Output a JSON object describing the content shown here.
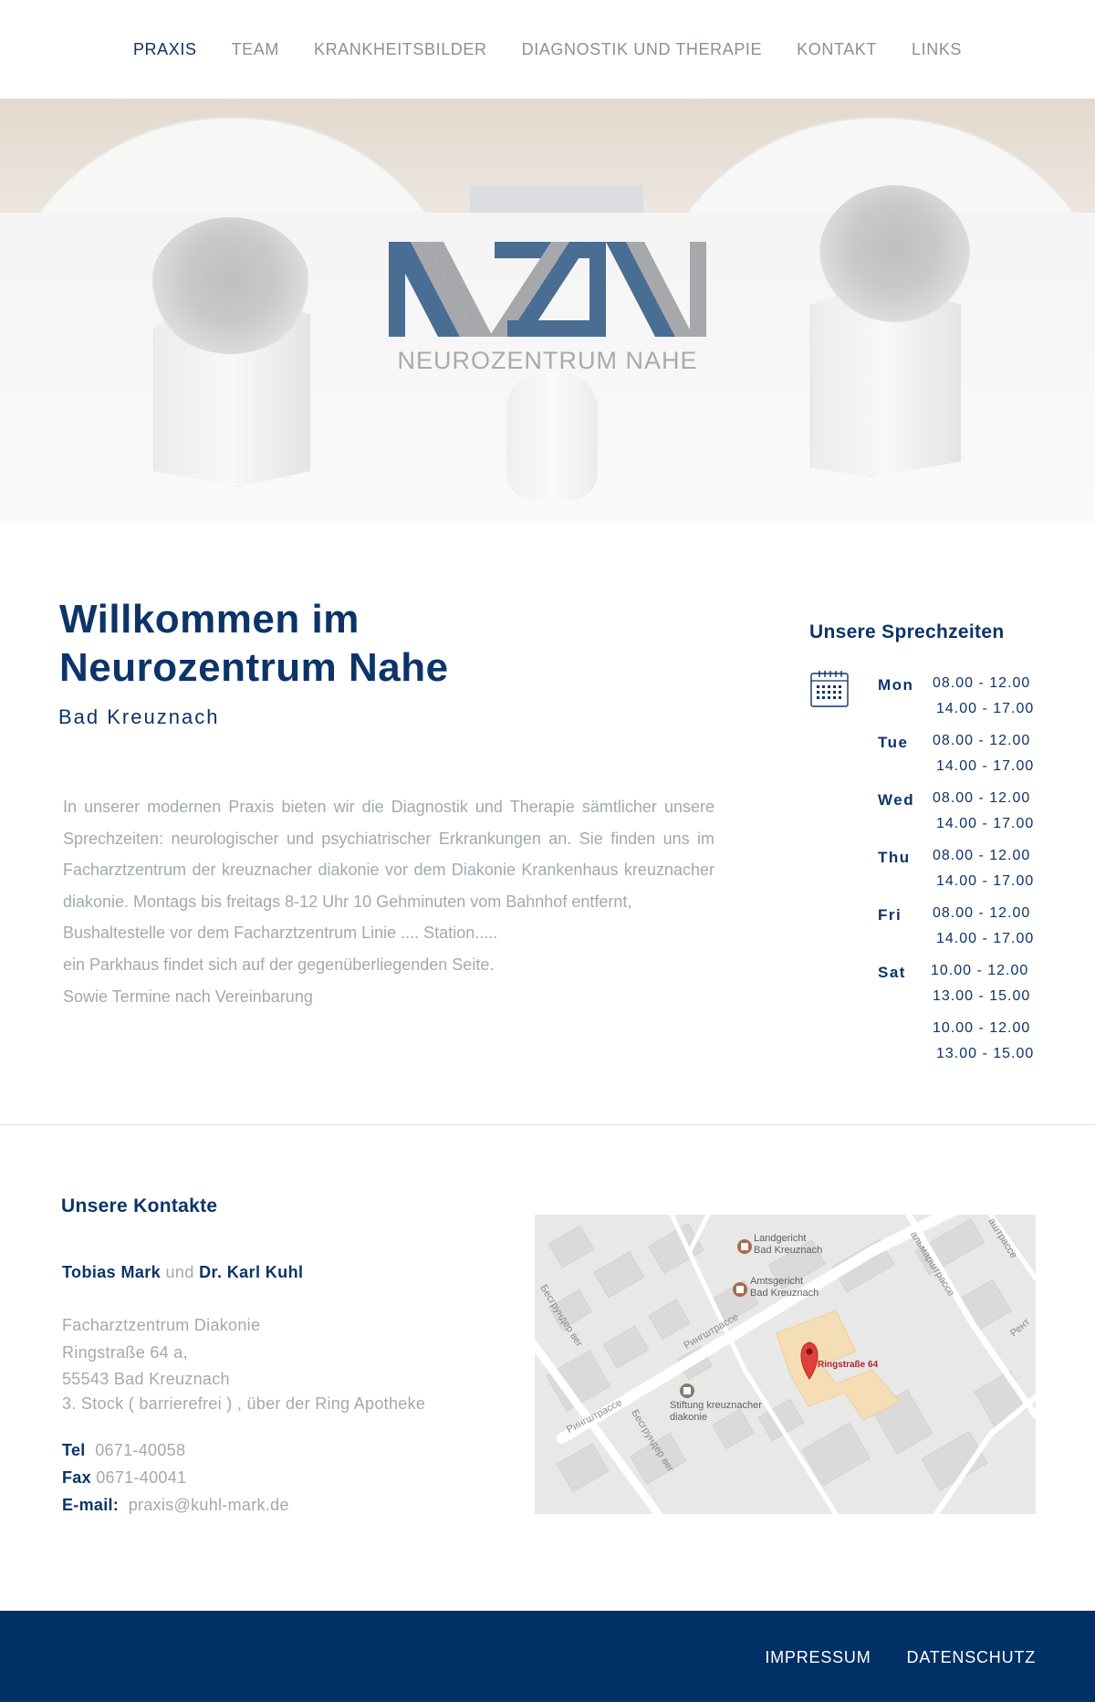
{
  "nav": {
    "items": [
      {
        "label": "PRAXIS"
      },
      {
        "label": "TEAM"
      },
      {
        "label": "KRANKHEITSBILDER"
      },
      {
        "label": "DIAGNOSTIK UND THERAPIE"
      },
      {
        "label": "KONTAKT"
      },
      {
        "label": "LINKS"
      }
    ]
  },
  "hero": {
    "logo_mark": "NZN",
    "logo_text": "NEUROZENTRUM NAHE",
    "logo_colors": {
      "blue": "#4a6d94",
      "gray": "#a7a8ab"
    }
  },
  "welcome": {
    "title_line1": "Willkommen im",
    "title_line2": "Neurozentrum Nahe",
    "subtitle": "Bad Kreuznach",
    "paragraph": [
      "In unserer modernen Praxis bieten wir die Diagnostik und Therapie sämtlicher unsere Sprechzeiten: neurologischer und psychiatrischer Erkrankungen an. Sie finden uns im Facharztzentrum der kreuznacher diakonie vor dem Diakonie Krankenhaus kreuznacher diakonie. Montags bis freitags 8-12 Uhr  10 Gehminuten vom Bahnhof entfernt,",
      "Bushaltestelle vor dem Facharztzentrum Linie .... Station.....",
      "ein Parkhaus findet sich auf der gegenüberliegenden Seite.",
      "Sowie Termine nach Vereinbarung"
    ]
  },
  "hours": {
    "title": "Unsere Sprechzeiten",
    "icon": "calendar-icon",
    "rows": [
      {
        "day": "Mon",
        "t1": "08.00 - 12.00",
        "t2": "14.00 - 17.00"
      },
      {
        "day": "Tue",
        "t1": "08.00 - 12.00",
        "t2": "14.00 - 17.00"
      },
      {
        "day": "Wed",
        "t1": "08.00 - 12.00",
        "t2": "14.00 - 17.00"
      },
      {
        "day": "Thu",
        "t1": "08.00 - 12.00",
        "t2": "14.00 - 17.00"
      },
      {
        "day": "Fri",
        "t1": "08.00 - 12.00",
        "t2": "14.00 - 17.00"
      },
      {
        "day": "Sat",
        "t1": "10.00 - 12.00",
        "t2": "13.00 - 15.00"
      },
      {
        "day": "",
        "t1": "10.00 - 12.00",
        "t2": "13.00 - 15.00"
      }
    ]
  },
  "contact": {
    "title": "Unsere Kontakte",
    "doctor1": "Tobias Mark",
    "connector": "und",
    "doctor2": "Dr. Karl Kuhl",
    "address": [
      "Facharztzentrum Diakonie",
      "Ringstraße 64 a,",
      "55543 Bad Kreuznach",
      "3. Stock ( barrierefrei ) ,  über der Ring Apotheke"
    ],
    "tel_label": "Tel",
    "tel": "0671-40058",
    "fax_label": "Fax",
    "fax": "0671-40041",
    "email_label": "E-mail:",
    "email": "praxis@kuhl-mark.de"
  },
  "map": {
    "places": [
      {
        "name_line1": "Landgericht",
        "name_line2": "Bad Kreuznach"
      },
      {
        "name_line1": "Amtsgericht",
        "name_line2": "Bad Kreuznach"
      },
      {
        "name_line1": "Stiftung kreuznacher",
        "name_line2": "diakonie"
      }
    ],
    "pin_label": "Ringstraße 64",
    "streets": [
      "Рингштрассе",
      "Рингштрассе",
      "Бесгрундер вег",
      "Бесгрундер вег",
      "альмарштрассе",
      "аштрассе",
      "Рент"
    ],
    "pin_color": "#e0403a"
  },
  "footer": {
    "links": [
      {
        "label": "IMPRESSUM"
      },
      {
        "label": "DATENSCHUTZ"
      }
    ],
    "bg_color": "#003066"
  }
}
